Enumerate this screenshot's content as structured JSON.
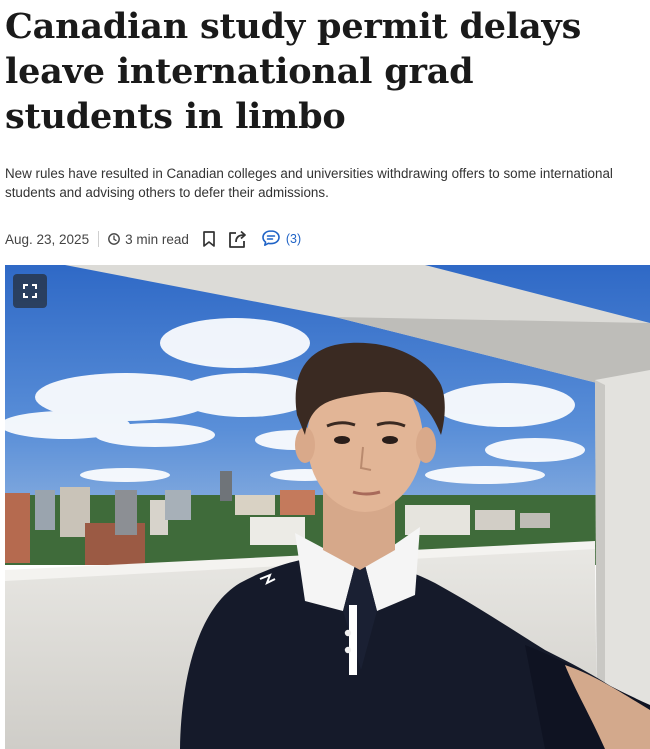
{
  "article": {
    "headline": "Canadian study permit delays leave international grad students in limbo",
    "dek": "New rules have resulted in Canadian colleges and universities withdrawing offers to some international students and advising others to defer their admissions.",
    "date": "Aug. 23, 2025",
    "read_time": "3 min read",
    "comment_count": "(3)"
  },
  "icons": {
    "clock": "clock-icon",
    "bookmark": "bookmark-icon",
    "share": "share-icon",
    "comment": "comment-icon",
    "expand": "expand-icon"
  },
  "colors": {
    "headline": "#1a1a1a",
    "accent_link": "#1f63c6",
    "sky": "#3f78cf"
  }
}
